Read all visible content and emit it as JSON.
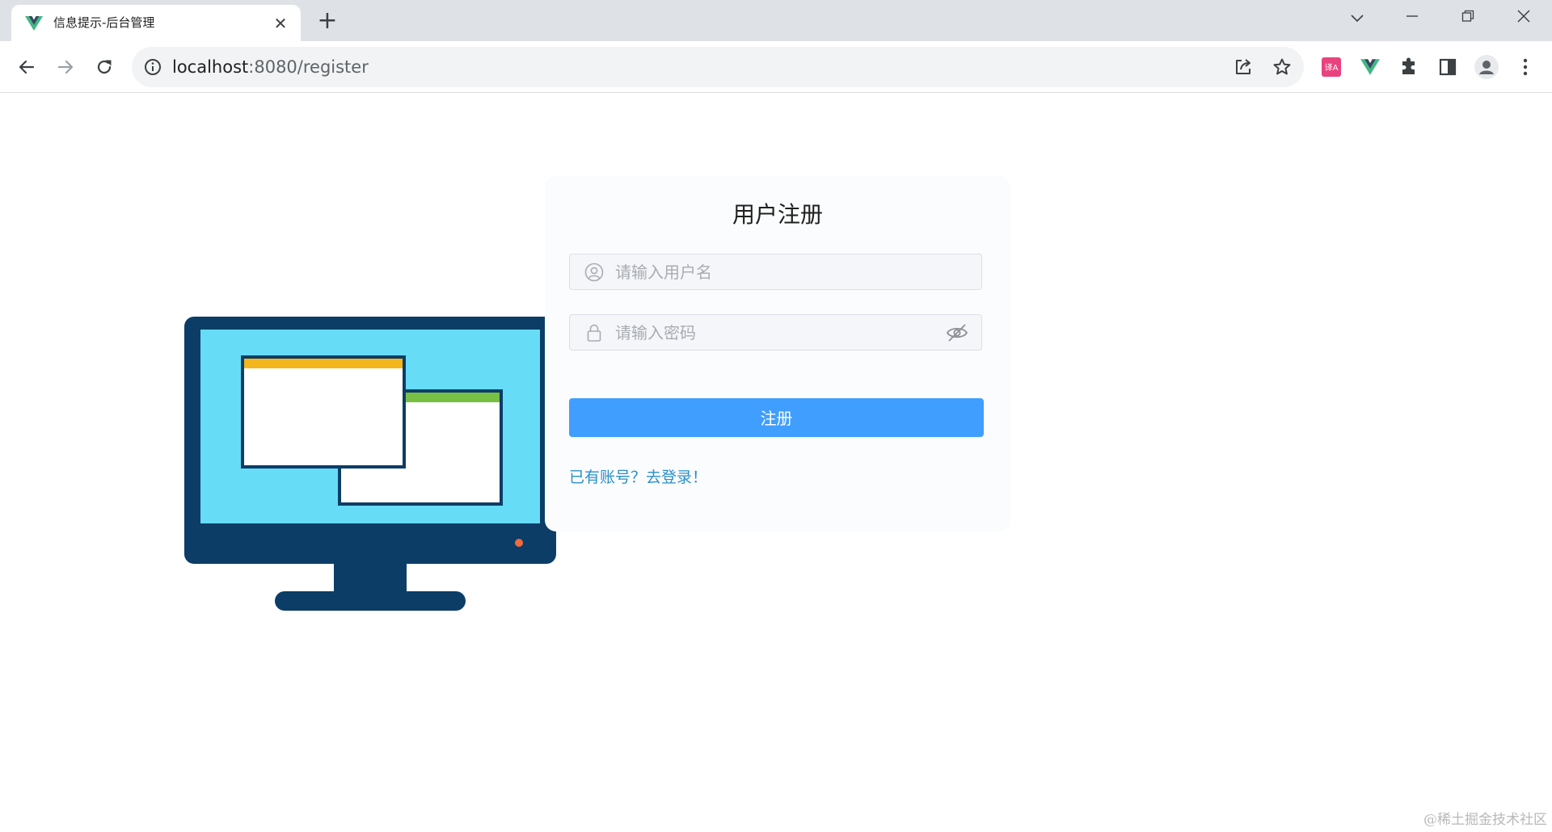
{
  "browser": {
    "tab_title": "信息提示-后台管理",
    "tab_close_glyph": "✕",
    "new_tab_glyph": "+",
    "url_host": "localhost",
    "url_rest": ":8080/register",
    "favicon": "vue-logo-icon",
    "toolbar_icons": [
      "back-icon",
      "forward-icon",
      "reload-icon",
      "site-info-icon",
      "share-icon",
      "bookmark-star-icon"
    ],
    "extension_icons": [
      "translate-extension-icon",
      "vue-devtools-icon",
      "extensions-puzzle-icon",
      "side-panel-icon",
      "profile-avatar-icon",
      "menu-kebab-icon"
    ],
    "window_controls": [
      "tab-search-chevron-icon",
      "minimize-icon",
      "restore-icon",
      "close-window-icon"
    ]
  },
  "page": {
    "title": "用户注册",
    "username_placeholder": "请输入用户名",
    "password_placeholder": "请输入密码",
    "register_button": "注册",
    "login_link": "已有账号？去登录！",
    "watermark": "@稀土掘金技术社区"
  },
  "colors": {
    "primary": "#409eff",
    "link": "#2a8fc8",
    "monitor_frame": "#0b3d66",
    "monitor_screen": "#67dcf7",
    "window_bar_yellow": "#f3b61c",
    "window_bar_green": "#78c043"
  }
}
